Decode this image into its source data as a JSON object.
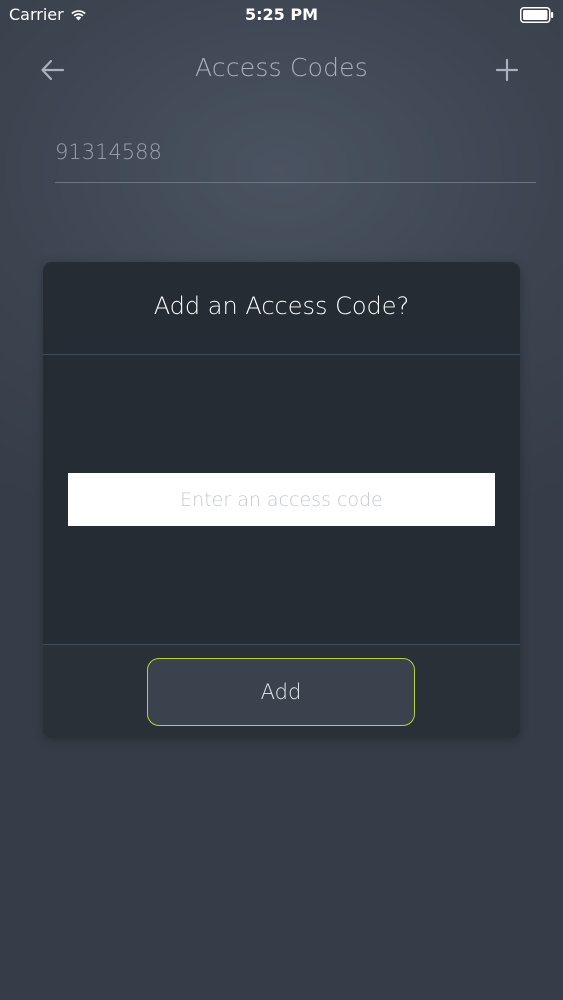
{
  "status_bar": {
    "carrier": "Carrier",
    "time": "5:25 PM"
  },
  "nav": {
    "title": "Access Codes",
    "back_icon": "arrow-left-icon",
    "add_icon": "plus-icon"
  },
  "codes": [
    {
      "value": "91314588"
    }
  ],
  "dialog": {
    "title": "Add an Access Code?",
    "input_placeholder": "Enter an access code",
    "input_value": "",
    "add_button_label": "Add"
  },
  "colors": {
    "background": "#3c4450",
    "dialog_background": "#262c33",
    "accent_border": "#b6d23a",
    "divider": "#3d4d5c"
  }
}
